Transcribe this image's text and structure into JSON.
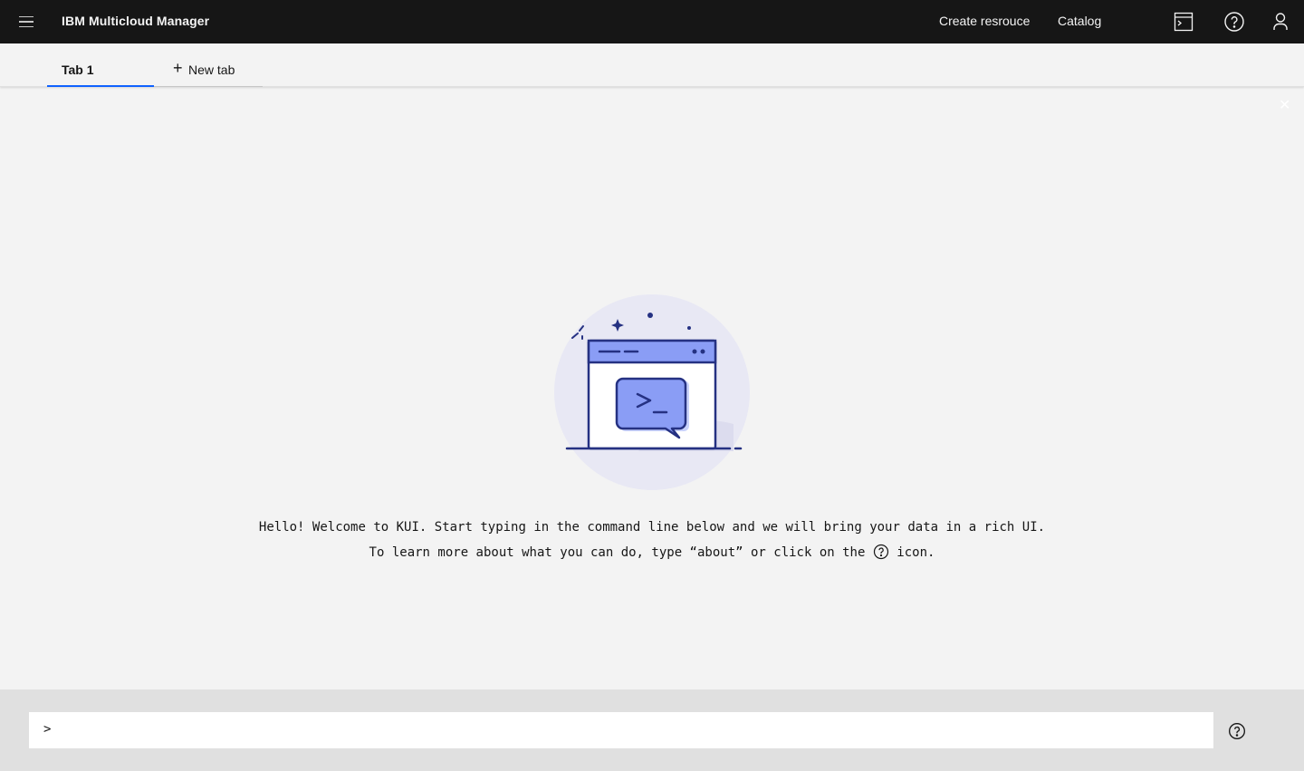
{
  "header": {
    "brand": "IBM Multicloud Manager",
    "nav": {
      "create_resource": "Create resrouce",
      "catalog": "Catalog"
    },
    "icons": [
      "menu-icon",
      "terminal-icon",
      "help-icon",
      "user-icon"
    ]
  },
  "tabs": {
    "items": [
      {
        "label": "Tab 1",
        "active": true
      }
    ],
    "new_tab_label": "New tab"
  },
  "close_glyph": "✕",
  "welcome": {
    "line1": "Hello! Welcome to KUI. Start typing in the command line below and we will bring your data in a rich UI.",
    "line2_before": "To learn more about what you can do, type “about” or click on the",
    "line2_after": "icon."
  },
  "command": {
    "prompt": ">",
    "value": "",
    "placeholder": ""
  },
  "colors": {
    "header_bg": "#161616",
    "accent": "#0f62fe",
    "illustration_primary": "#8a9df5",
    "illustration_stroke": "#253182"
  }
}
